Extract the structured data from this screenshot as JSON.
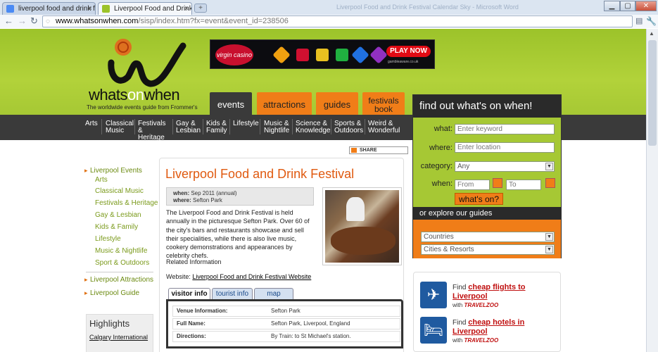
{
  "browser": {
    "tabs": [
      {
        "title": "liverpool food and drink f..."
      },
      {
        "title": "Liverpool Food and Drink..."
      }
    ],
    "new_tab_glyph": "+",
    "window_title": "Liverpool Food and Drink Festival Calendar Sky - Microsoft Word",
    "url_domain": "www.whatsonwhen.com",
    "url_path": "/sisp/index.htm?fx=event&event_id=238506"
  },
  "site": {
    "logo_what": "whats",
    "logo_on": "on",
    "logo_when": "when",
    "tagline": "The worldwide events guide from Frommer's",
    "main_tabs": {
      "events": "events",
      "attractions": "attractions",
      "guides": "guides",
      "festivals": "festivals book"
    },
    "subnav": [
      "Arts",
      "Classical Music",
      "Festivals & Heritage",
      "Gay & Lesbian",
      "Kids & Family",
      "Lifestyle",
      "Music & Nightlife",
      "Science & Knowledge",
      "Sports & Outdoors",
      "Weird & Wonderful"
    ]
  },
  "banner": {
    "brand": "virgin casino",
    "cta": "PLAY NOW",
    "footer": "gambleaware.co.uk"
  },
  "find": {
    "heading": "find out what's on when!",
    "what_label": "what:",
    "what_placeholder": "Enter keyword",
    "where_label": "where:",
    "where_placeholder": "Enter location",
    "category_label": "category:",
    "category_value": "Any",
    "when_label": "when:",
    "from_placeholder": "From",
    "to_placeholder": "To",
    "submit": "what's on?",
    "explore_heading": "or explore our guides",
    "countries": "Countries",
    "cities": "Cities & Resorts"
  },
  "share_label": "SHARE",
  "leftnav": {
    "events": "Liverpool Events",
    "event_cats": [
      "Arts",
      "Classical Music",
      "Festivals & Heritage",
      "Gay & Lesbian",
      "Kids & Family",
      "Lifestyle",
      "Music & Nightlife",
      "Sport & Outdoors"
    ],
    "attractions": "Liverpool Attractions",
    "guide": "Liverpool Guide",
    "highlights_title": "Highlights",
    "highlight_item": "Calgary International"
  },
  "event": {
    "title": "Liverpool Food and Drink Festival",
    "when_label": "when:",
    "when_value": "Sep 2011 (annual)",
    "where_label": "where:",
    "where_value": "Sefton Park",
    "description": "The Liverpool Food and Drink Festival is held annually in the picturesque Sefton Park. Over 60 of the city's bars and restaurants showcase and sell their specialities, while there is also live music, cookery demonstrations and appearances by celebrity chefs.",
    "related": "Related Information",
    "website_label": "Website:",
    "website_link": "Liverpool Food and Drink Festival Website",
    "info_tabs": [
      "visitor info",
      "tourist info",
      "map"
    ],
    "info_rows": [
      {
        "k": "Venue Information:",
        "v": "Sefton Park"
      },
      {
        "k": "Full Name:",
        "v": "Sefton Park, Liverpool, England"
      },
      {
        "k": "Directions:",
        "v": "By Train: to St Michael's station."
      }
    ]
  },
  "travel": {
    "flights_prefix": "Find",
    "flights_link": "cheap flights to Liverpool",
    "hotels_prefix": "Find",
    "hotels_link": "cheap hotels in Liverpool",
    "with": "with",
    "partner": "TRAVELZOO"
  },
  "colors": {
    "header_green": "#a6c834",
    "orange": "#f07d18",
    "dark": "#3a3a3a",
    "title_orange": "#e05a10"
  }
}
